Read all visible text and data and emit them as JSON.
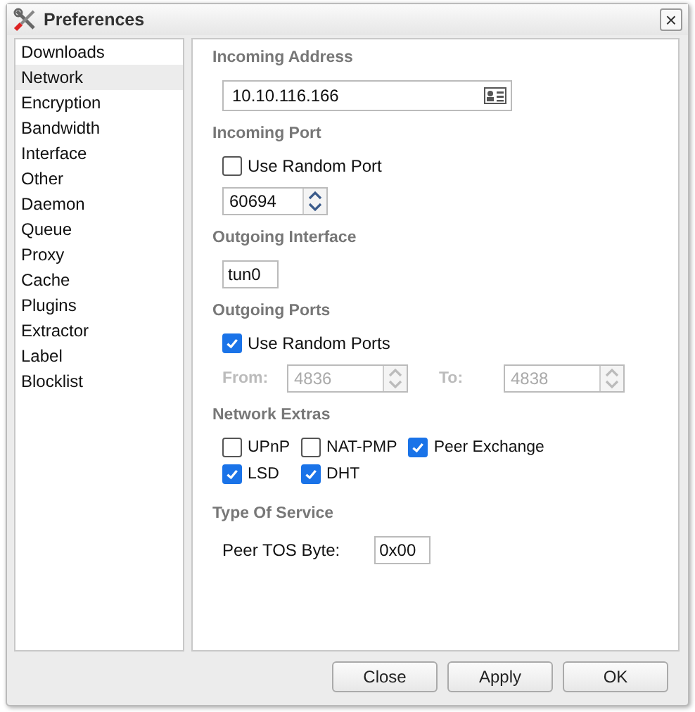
{
  "window": {
    "title": "Preferences",
    "close": "×"
  },
  "sidebar": {
    "items": [
      {
        "label": "Downloads",
        "selected": false
      },
      {
        "label": "Network",
        "selected": true
      },
      {
        "label": "Encryption",
        "selected": false
      },
      {
        "label": "Bandwidth",
        "selected": false
      },
      {
        "label": "Interface",
        "selected": false
      },
      {
        "label": "Other",
        "selected": false
      },
      {
        "label": "Daemon",
        "selected": false
      },
      {
        "label": "Queue",
        "selected": false
      },
      {
        "label": "Proxy",
        "selected": false
      },
      {
        "label": "Cache",
        "selected": false
      },
      {
        "label": "Plugins",
        "selected": false
      },
      {
        "label": "Extractor",
        "selected": false
      },
      {
        "label": "Label",
        "selected": false
      },
      {
        "label": "Blocklist",
        "selected": false
      }
    ]
  },
  "sections": [
    {
      "heading": "Incoming Address",
      "controls": [
        {
          "kind": "address_field",
          "value": "10.10.116.166"
        }
      ]
    },
    {
      "heading": "Incoming Port",
      "controls": [
        {
          "kind": "checkbox",
          "label": "Use Random Port",
          "checked": false
        },
        {
          "kind": "spinner",
          "value": "60694",
          "disabled": false
        }
      ]
    },
    {
      "heading": "Outgoing Interface",
      "controls": [
        {
          "kind": "text_field",
          "value": "tun0"
        }
      ]
    },
    {
      "heading": "Outgoing Ports",
      "controls": [
        {
          "kind": "checkbox",
          "label": "Use Random Ports",
          "checked": true
        },
        {
          "kind": "range",
          "from_label": "From:",
          "from_value": "4836",
          "to_label": "To:",
          "to_value": "4838",
          "disabled": true
        }
      ]
    },
    {
      "heading": "Network Extras",
      "controls": [
        {
          "kind": "checkbox_grid",
          "rows": [
            [
              {
                "label": "UPnP",
                "checked": false
              },
              {
                "label": "NAT-PMP",
                "checked": false
              },
              {
                "label": "Peer Exchange",
                "checked": true
              }
            ],
            [
              {
                "label": "LSD",
                "checked": true
              },
              {
                "label": "DHT",
                "checked": true
              }
            ]
          ]
        }
      ]
    },
    {
      "heading": "Type Of Service",
      "controls": [
        {
          "kind": "labeled_field",
          "label": "Peer TOS Byte:",
          "value": "0x00"
        }
      ]
    }
  ],
  "buttons": [
    "Close",
    "Apply",
    "OK"
  ]
}
